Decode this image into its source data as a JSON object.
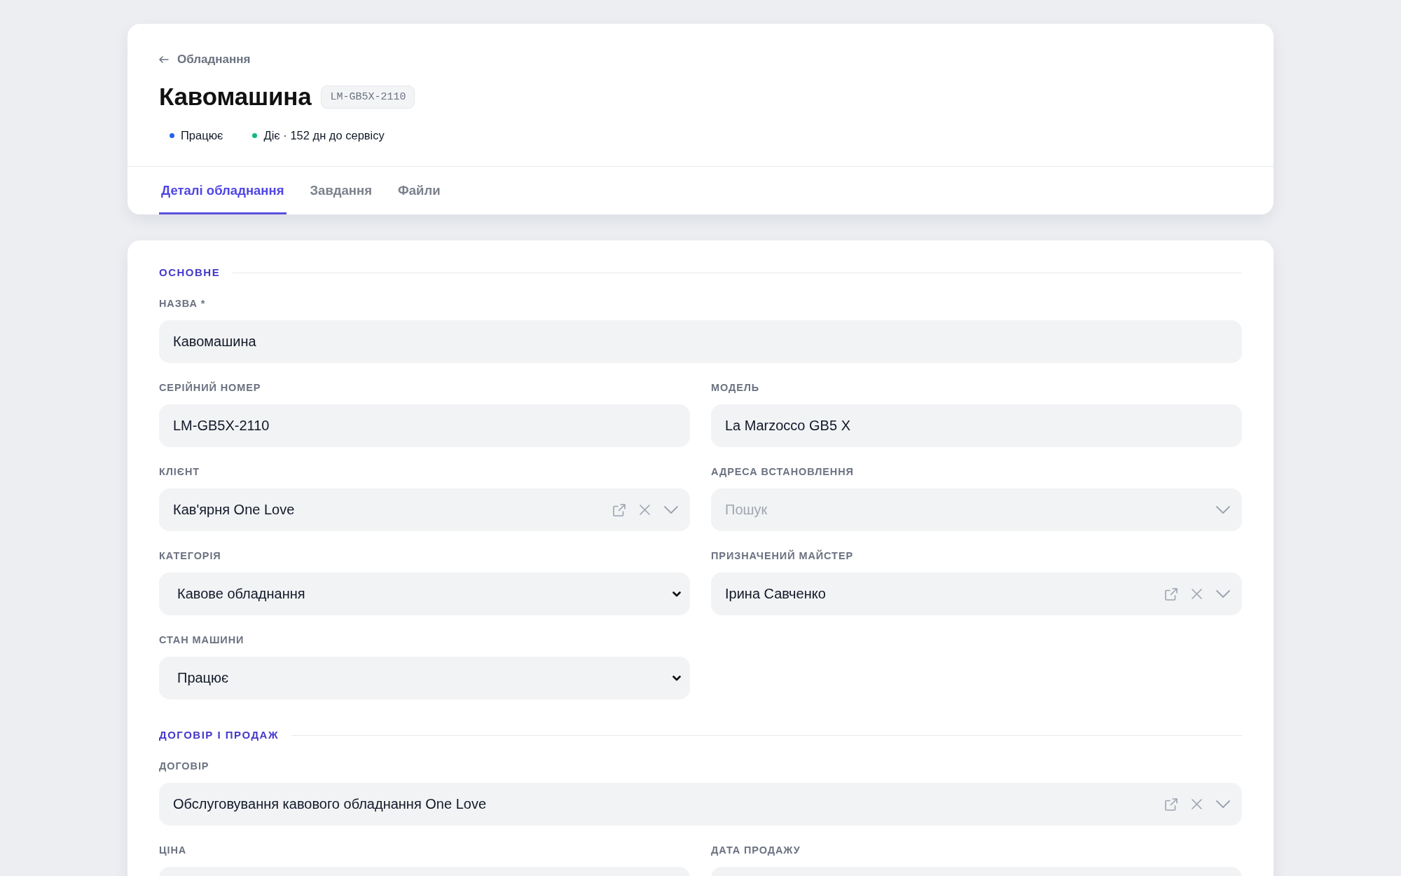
{
  "breadcrumb": {
    "label": "Обладнання"
  },
  "header": {
    "title": "Кавомашина",
    "code": "LM-GB5X-2110",
    "statuses": [
      {
        "label": "Працює",
        "color": "#2563eb"
      },
      {
        "label": "Діє · 152 дн до сервісу",
        "color": "#10b981"
      }
    ]
  },
  "tabs": [
    {
      "label": "Деталі обладнання",
      "selected": true
    },
    {
      "label": "Завдання",
      "selected": false
    },
    {
      "label": "Файли",
      "selected": false
    }
  ],
  "sections": [
    {
      "title": "ОСНОВНЕ",
      "fields": [
        {
          "label": "НАЗВА *",
          "kind": "text",
          "wide": true,
          "value": "Кавомашина"
        },
        {
          "label": "СЕРІЙНИЙ НОМЕР",
          "kind": "text",
          "wide": false,
          "value": "LM-GB5X-2110"
        },
        {
          "label": "МОДЕЛЬ",
          "kind": "text",
          "wide": false,
          "value": "La Marzocco GB5 X"
        },
        {
          "label": "КЛІЄНТ",
          "kind": "lookup",
          "wide": false,
          "value": "Кав'ярня One Love"
        },
        {
          "label": "АДРЕСА ВСТАНОВЛЕННЯ",
          "kind": "lookup",
          "wide": false,
          "placeholder": "Пошук"
        },
        {
          "label": "КАТЕГОРІЯ",
          "kind": "select",
          "wide": false,
          "value": "Кавове обладнання"
        },
        {
          "label": "ПРИЗНАЧЕНИЙ МАЙСТЕР",
          "kind": "lookup",
          "wide": false,
          "value": "Ірина Савченко"
        },
        {
          "label": "СТАН МАШИНИ",
          "kind": "select",
          "wide": false,
          "value": "Працює"
        }
      ]
    },
    {
      "title": "ДОГОВІР І ПРОДАЖ",
      "fields": [
        {
          "label": "ДОГОВІР",
          "kind": "lookup",
          "wide": true,
          "value": "Обслуговування кавового обладнання One Love"
        },
        {
          "label": "ЦІНА",
          "kind": "text",
          "wide": false
        },
        {
          "label": "ДАТА ПРОДАЖУ",
          "kind": "text",
          "wide": false
        }
      ]
    }
  ]
}
